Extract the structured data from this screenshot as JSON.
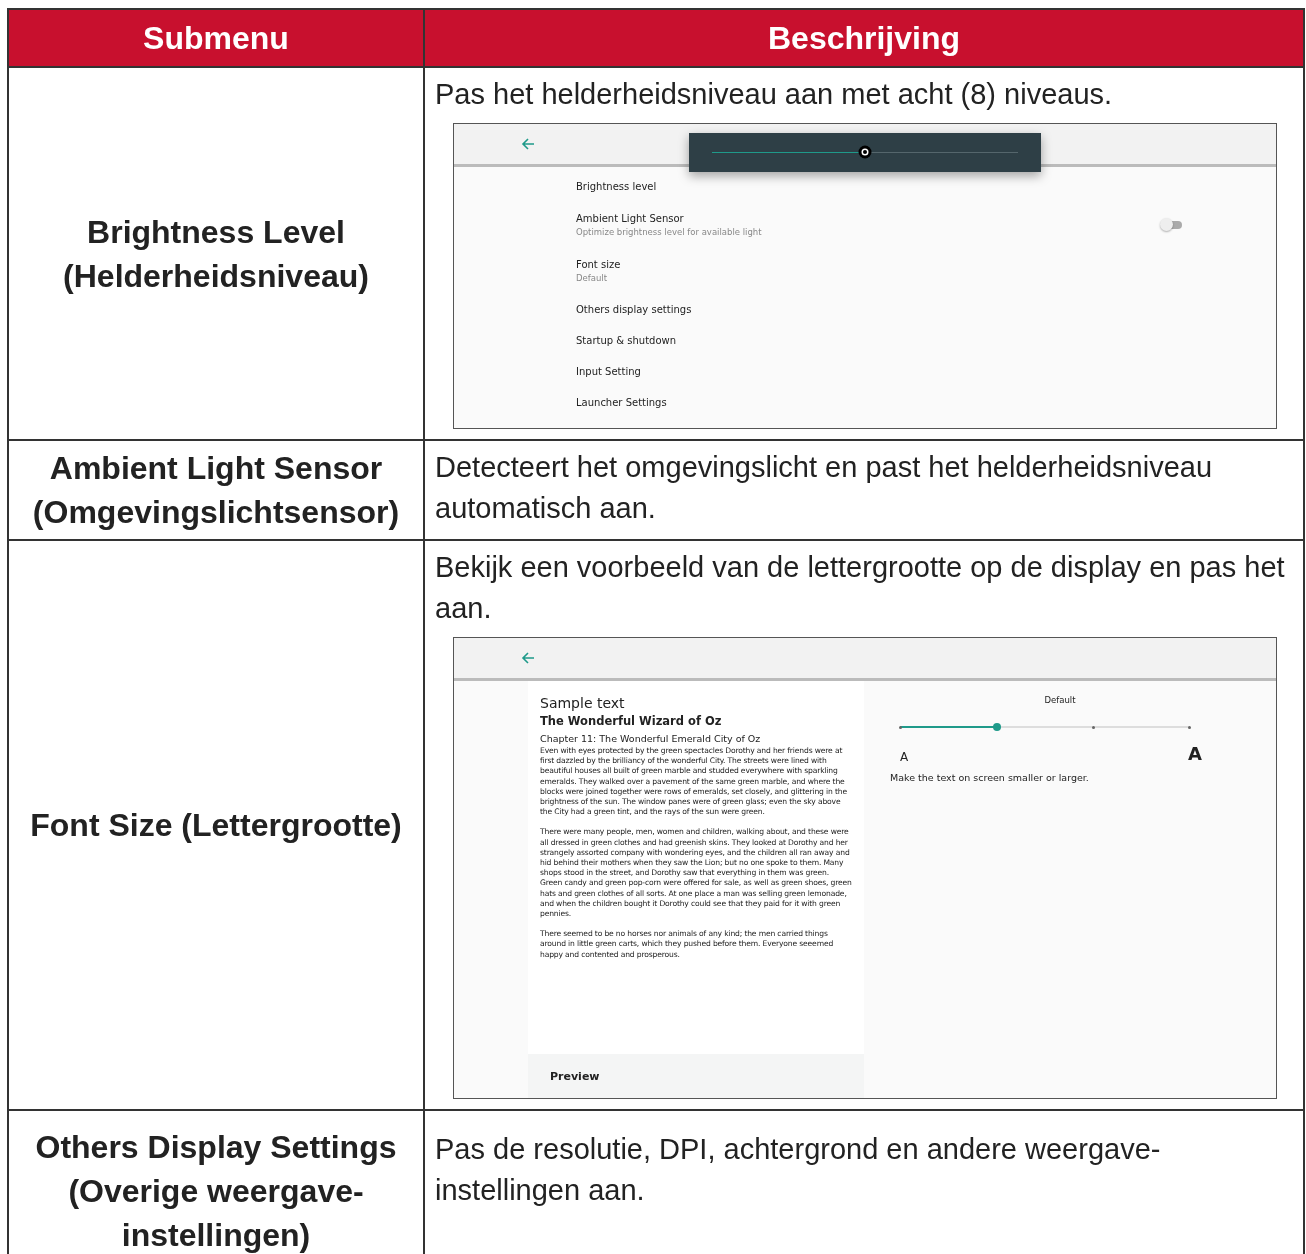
{
  "table": {
    "columns": [
      "Submenu",
      "Beschrijving"
    ],
    "rows": [
      {
        "submenu_lines": [
          "Brightness Level",
          "(Helderheidsniveau)"
        ],
        "description": "Pas het helderheidsniveau aan met acht (8) niveaus.",
        "screen": {
          "kind": "brightness",
          "slider": {
            "level": 0.5
          },
          "items": [
            {
              "label": "Brightness level"
            },
            {
              "label": "Ambient Light Sensor",
              "sublabel": "Optimize brightness level for available light",
              "toggle": {
                "on": false
              }
            },
            {
              "label": "Font size",
              "sublabel": "Default"
            },
            {
              "label": "Others display settings"
            },
            {
              "label": "Startup & shutdown"
            },
            {
              "label": "Input Setting"
            },
            {
              "label": "Launcher Settings"
            }
          ]
        }
      },
      {
        "submenu_lines": [
          "Ambient Light Sensor",
          "(Omgevingslichtsensor)"
        ],
        "description": "Detecteert het omgevingslicht en past het helderheidsniveau automatisch aan."
      },
      {
        "submenu_lines": [
          "Font Size (Lettergrootte)"
        ],
        "description": "Bekijk een voorbeeld van de lettergrootte op de display en pas het aan.",
        "screen": {
          "kind": "fontsize",
          "sample_label": "Sample text",
          "book_title": "The Wonderful Wizard of Oz",
          "chapter": "Chapter 11: The Wonderful Emerald City of Oz",
          "paragraphs": [
            "Even with eyes protected by the green spectacles Dorothy and her friends were at first dazzled by the brilliancy of the wonderful City. The streets were lined with beautiful houses all built of green marble and studded everywhere with sparkling emeralds. They walked over a pavement of the same green marble, and where the blocks were joined together were rows of emeralds, set closely, and glittering in the brightness of the sun. The window panes were of green glass; even the sky above the City had a green tint, and the rays of the sun were green.",
            "There were many people, men, women and children, walking about, and these were all dressed in green clothes and had greenish skins. They looked at Dorothy and her strangely assorted company with wondering eyes, and the children all ran away and hid behind their mothers when they saw the Lion; but no one spoke to them. Many shops stood in the street, and Dorothy saw that everything in them was green. Green candy and green pop-corn were offered for sale, as well as green shoes, green hats and green clothes of all sorts. At one place a man was selling green lemonade, and when the children bought it Dorothy could see that they paid for it with green pennies.",
            "There seemed to be no horses nor animals of any kind; the men carried things around in little green carts, which they pushed before them. Everyone seeemed happy and contented and prosperous."
          ],
          "preview_label": "Preview",
          "size_label": "Default",
          "slider": {
            "level": 0.333
          },
          "small_a": "A",
          "large_a": "A",
          "hint": "Make the text on screen smaller or larger."
        }
      },
      {
        "submenu_lines": [
          "Others Display Settings",
          "(Overige weergave-",
          "instellingen)"
        ],
        "description": "Pas de resolutie, DPI, achtergrond en andere weergave-instellingen aan."
      }
    ]
  }
}
